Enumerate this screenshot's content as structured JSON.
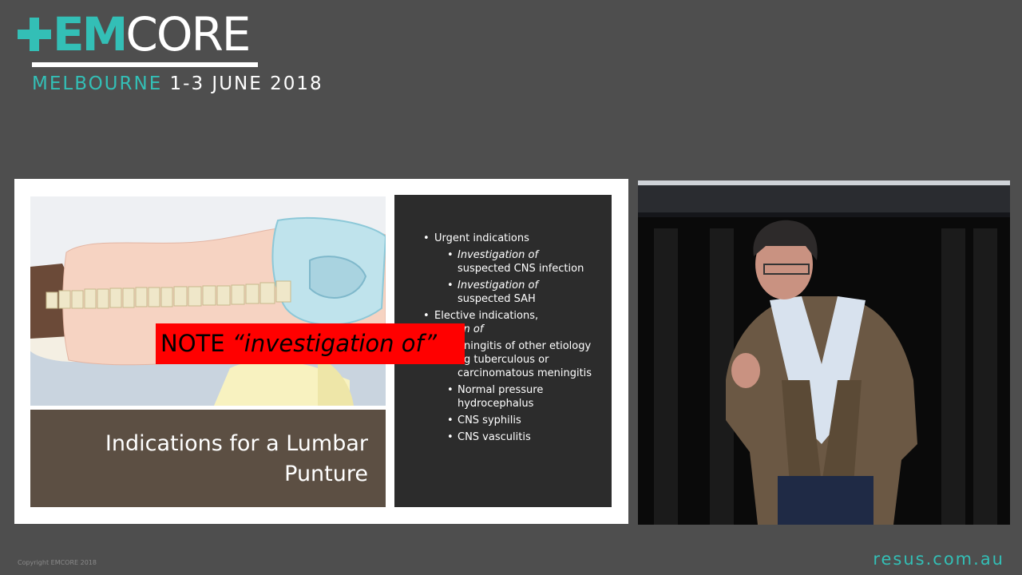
{
  "brand": {
    "logo_em": "EM",
    "logo_core": "CORE",
    "city": "MELBOURNE",
    "dates": "1-3 JUNE 2018",
    "accent_color": "#33bfb6"
  },
  "slide": {
    "title_line1": "Indications for a Lumbar",
    "title_line2": "Punture",
    "note_prefix": "NOTE",
    "note_quote": "“investigation of”",
    "urgent": {
      "label": "Urgent indications",
      "items": [
        {
          "italic": "Investigation of",
          "rest": "suspected CNS infection"
        },
        {
          "italic": "Investigation of",
          "rest": "suspected SAH"
        }
      ]
    },
    "elective": {
      "label": "Elective indications,",
      "label_italic": "igation of",
      "items": [
        "eningitis of other etiology eg tuberculous or carcinomatous meningitis",
        "Normal pressure hydrocephalus",
        "CNS syphilis",
        "CNS vasculitis"
      ]
    }
  },
  "footer": {
    "copyright": "Copyright EMCORE 2018",
    "site": "resus.com.au"
  }
}
